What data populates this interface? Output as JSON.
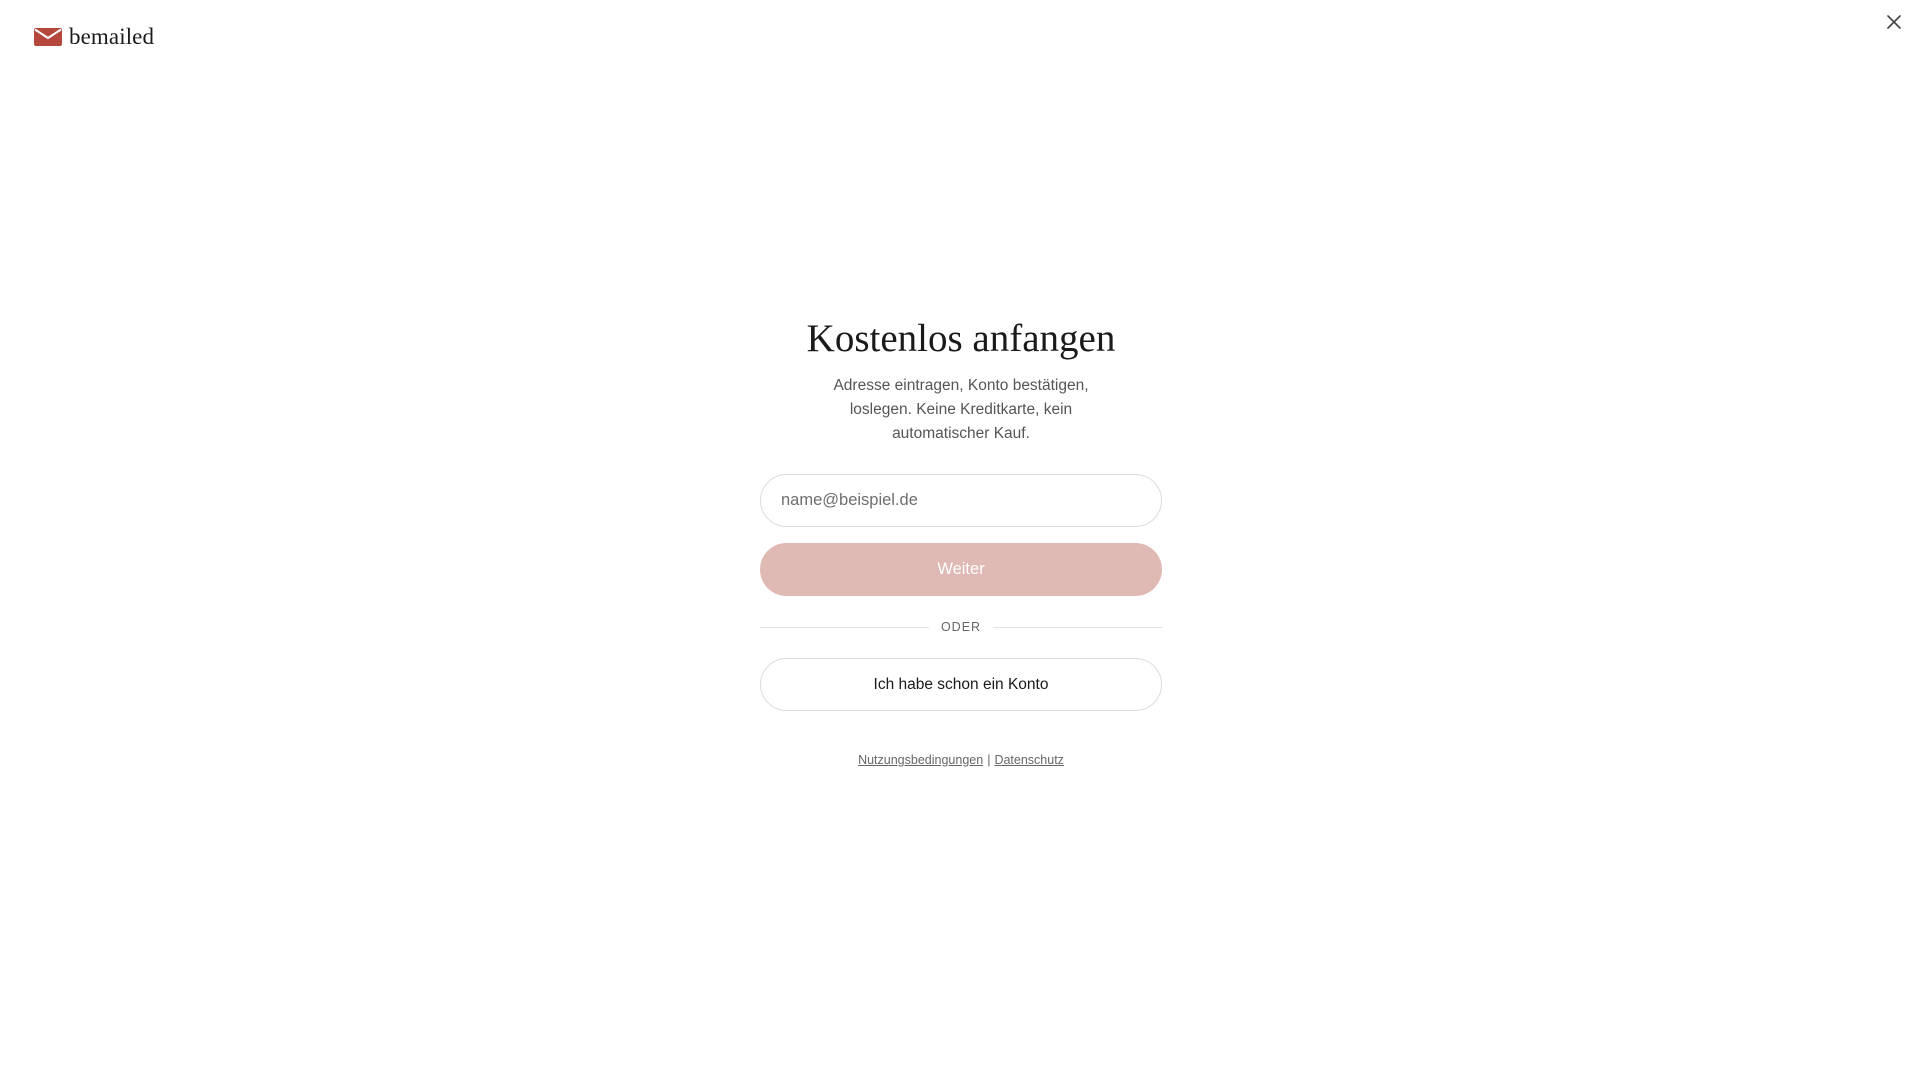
{
  "brand": {
    "name": "bemailed",
    "icon": "envelope-icon",
    "accent_color": "#b5473d"
  },
  "header": {
    "close_icon": "close-icon"
  },
  "signup": {
    "title": "Kostenlos anfangen",
    "subtitle": "Adresse eintragen, Konto bestätigen, loslegen. Keine Kreditkarte, kein automatischer Kauf.",
    "email_placeholder": "name@beispiel.de",
    "email_value": "",
    "continue_label": "Weiter",
    "continue_color": "#dfb9b3",
    "divider_label": "ODER",
    "login_label": "Ich habe schon ein Konto"
  },
  "footer": {
    "terms_label": "Nutzungsbedingungen",
    "separator": "|",
    "privacy_label": "Datenschutz"
  }
}
